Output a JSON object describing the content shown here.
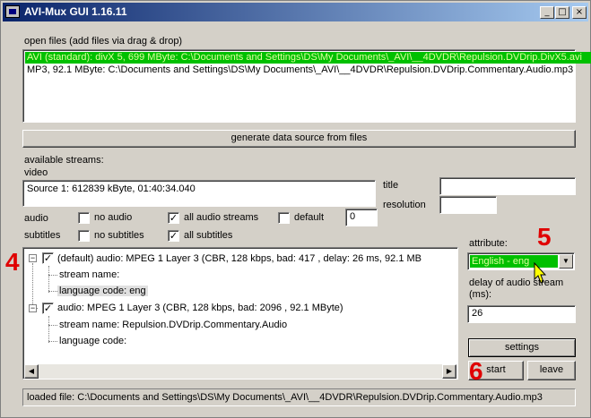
{
  "window": {
    "title": "AVI-Mux GUI 1.16.11"
  },
  "title_buttons": {
    "minimize": "_",
    "maximize": "□",
    "close": "×"
  },
  "open_files": {
    "label": "open files (add files via drag & drop)",
    "items": [
      "AVI (standard): divX 5, 699 MByte: C:\\Documents and Settings\\DS\\My Documents\\_AVI\\__4DVDR\\Repulsion.DVDrip.DivX5.avi",
      "MP3, 92.1 MByte: C:\\Documents and Settings\\DS\\My Documents\\_AVI\\__4DVDR\\Repulsion.DVDrip.Commentary.Audio.mp3"
    ]
  },
  "generate_button": "generate data source from files",
  "available_streams_label": "available streams:",
  "video": {
    "label": "video",
    "value": "Source 1: 612839 kByte, 01:40:34.040"
  },
  "title_field": {
    "label": "title",
    "value": ""
  },
  "resolution_field": {
    "label": "resolution",
    "value": ""
  },
  "audio_row": {
    "label": "audio",
    "no_audio": "no audio",
    "all_audio_streams": "all audio streams",
    "default": "default",
    "default_value": "0"
  },
  "subtitles_row": {
    "label": "subtitles",
    "no_subtitles": "no subtitles",
    "all_subtitles": "all subtitles"
  },
  "tree": {
    "item1": {
      "title": "(default) audio: MPEG 1 Layer 3 (CBR, 128 kbps, bad: 417 , delay: 26 ms, 92.1 MB",
      "stream_name": "stream name:",
      "language_code": "language code: eng"
    },
    "item2": {
      "title": "audio: MPEG 1 Layer 3 (CBR, 128 kbps, bad: 2096 , 92.1 MByte)",
      "stream_name": "stream name: Repulsion.DVDrip.Commentary.Audio",
      "language_code": "language code:"
    }
  },
  "attribute": {
    "label": "attribute:",
    "value": "English - eng"
  },
  "delay": {
    "label_line1": "delay of audio stream",
    "label_line2": "(ms):",
    "value": "26"
  },
  "buttons": {
    "settings": "settings",
    "start": "start",
    "leave": "leave"
  },
  "annotations": {
    "n4": "4",
    "n5": "5",
    "n6": "6"
  },
  "status_text": "loaded file: C:\\Documents and Settings\\DS\\My Documents\\_AVI\\__4DVDR\\Repulsion.DVDrip.Commentary.Audio.mp3",
  "check_glyph": "✓",
  "colors": {
    "selection_bg": "#00c000",
    "selection_text": "#e0ffa0",
    "annotation": "#e00000",
    "title_bar": "#0a246a"
  }
}
